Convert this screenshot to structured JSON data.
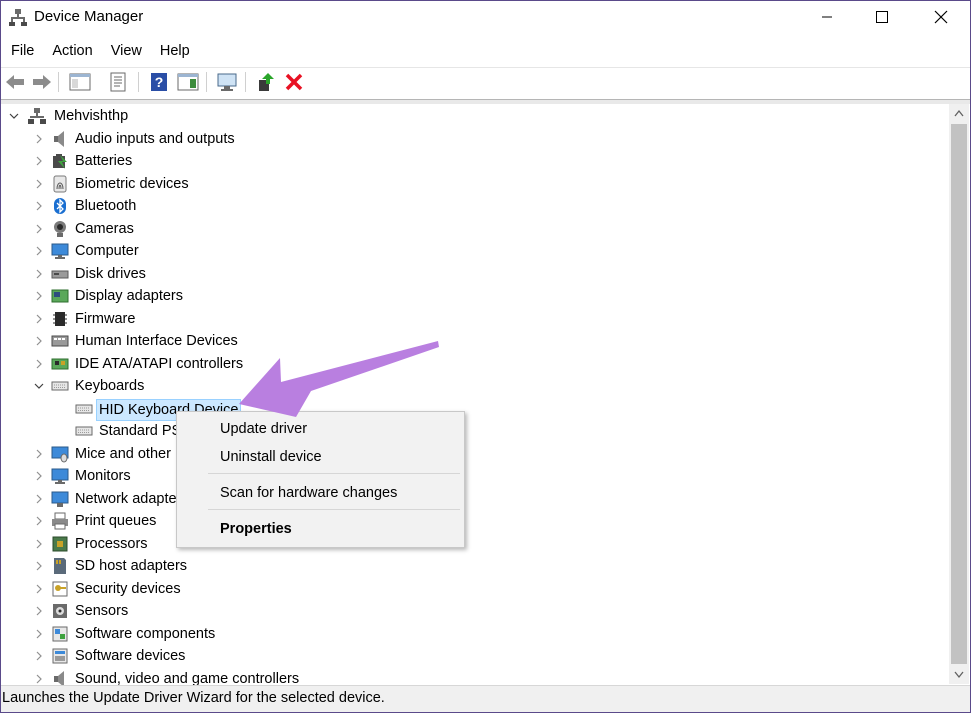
{
  "window": {
    "title": "Device Manager"
  },
  "menubar": [
    "File",
    "Action",
    "View",
    "Help"
  ],
  "toolbar": {
    "icons": [
      "back-icon",
      "forward-icon",
      "show-hide-tree-icon",
      "properties-icon",
      "help-icon",
      "action-pane-icon",
      "scan-hardware-icon",
      "update-driver-icon",
      "uninstall-device-icon"
    ]
  },
  "tree": {
    "root": "Mehvishthp",
    "categories": [
      {
        "label": "Audio inputs and outputs",
        "icon": "speaker-icon",
        "expanded": false
      },
      {
        "label": "Batteries",
        "icon": "battery-icon",
        "expanded": false
      },
      {
        "label": "Biometric devices",
        "icon": "fingerprint-icon",
        "expanded": false
      },
      {
        "label": "Bluetooth",
        "icon": "bluetooth-icon",
        "expanded": false
      },
      {
        "label": "Cameras",
        "icon": "camera-icon",
        "expanded": false
      },
      {
        "label": "Computer",
        "icon": "monitor-icon",
        "expanded": false
      },
      {
        "label": "Disk drives",
        "icon": "disk-drive-icon",
        "expanded": false
      },
      {
        "label": "Display adapters",
        "icon": "display-adapter-icon",
        "expanded": false
      },
      {
        "label": "Firmware",
        "icon": "chip-icon",
        "expanded": false
      },
      {
        "label": "Human Interface Devices",
        "icon": "hid-icon",
        "expanded": false
      },
      {
        "label": "IDE ATA/ATAPI controllers",
        "icon": "ide-controller-icon",
        "expanded": false
      },
      {
        "label": "Keyboards",
        "icon": "keyboard-icon",
        "expanded": true,
        "children": [
          {
            "label": "HID Keyboard Device",
            "icon": "keyboard-icon",
            "selected": true
          },
          {
            "label": "Standard PS",
            "icon": "keyboard-icon",
            "selected": false
          }
        ]
      },
      {
        "label": "Mice and other",
        "icon": "mouse-icon",
        "expanded": false
      },
      {
        "label": "Monitors",
        "icon": "monitor-icon",
        "expanded": false
      },
      {
        "label": "Network adapte",
        "icon": "network-adapter-icon",
        "expanded": false
      },
      {
        "label": "Print queues",
        "icon": "printer-icon",
        "expanded": false
      },
      {
        "label": "Processors",
        "icon": "processor-icon",
        "expanded": false
      },
      {
        "label": "SD host adapters",
        "icon": "sd-card-icon",
        "expanded": false
      },
      {
        "label": "Security devices",
        "icon": "security-key-icon",
        "expanded": false
      },
      {
        "label": "Sensors",
        "icon": "sensor-icon",
        "expanded": false
      },
      {
        "label": "Software components",
        "icon": "software-component-icon",
        "expanded": false
      },
      {
        "label": "Software devices",
        "icon": "software-device-icon",
        "expanded": false
      },
      {
        "label": "Sound, video and game controllers",
        "icon": "sound-icon",
        "expanded": false
      }
    ]
  },
  "context_menu": {
    "items": [
      {
        "label": "Update driver",
        "bold": false
      },
      {
        "label": "Uninstall device",
        "bold": false
      },
      {
        "label": "Scan for hardware changes",
        "bold": false
      },
      {
        "label": "Properties",
        "bold": true
      }
    ]
  },
  "statusbar": {
    "text": "Launches the Update Driver Wizard for the selected device."
  },
  "colors": {
    "selection": "#cce8ff",
    "annotation_arrow": "#b97fe0",
    "uninstall_red": "#e81123"
  }
}
